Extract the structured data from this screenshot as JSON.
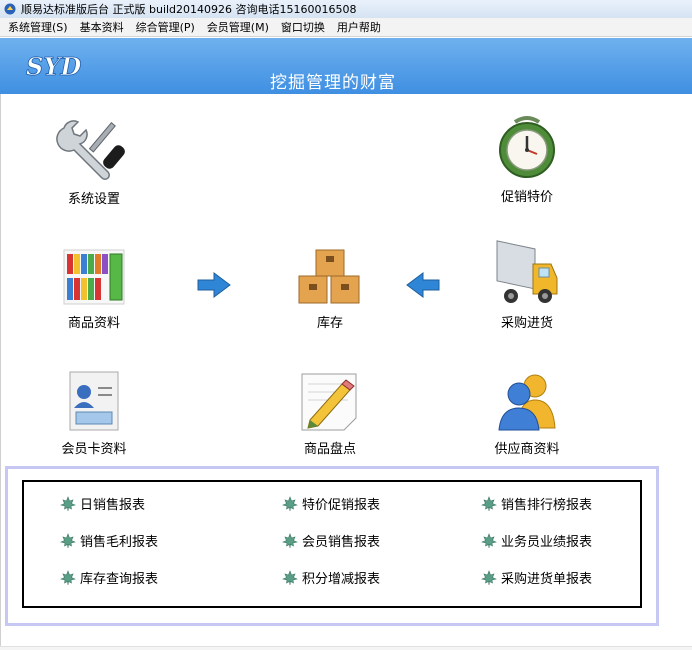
{
  "window": {
    "title": "顺易达标准版后台 正式版 build20140926 咨询电话15160016508"
  },
  "menu": [
    {
      "label": "系统管理(S)"
    },
    {
      "label": "基本资料"
    },
    {
      "label": "综合管理(P)"
    },
    {
      "label": "会员管理(M)"
    },
    {
      "label": "窗口切换"
    },
    {
      "label": "用户帮助"
    }
  ],
  "header": {
    "logo_text": "SYD",
    "slogan": "挖掘管理的财富",
    "colors": {
      "top": "#6fb1ee",
      "bottom": "#3f8fe2"
    }
  },
  "tiles": {
    "system_settings": {
      "label": "系统设置",
      "icon": "tools-icon"
    },
    "promotion": {
      "label": "促销特价",
      "icon": "alarm-clock-icon"
    },
    "product_info": {
      "label": "商品资料",
      "icon": "binders-icon"
    },
    "inventory": {
      "label": "库存",
      "icon": "boxes-icon"
    },
    "purchase": {
      "label": "采购进货",
      "icon": "delivery-truck-icon"
    },
    "member_card": {
      "label": "会员卡资料",
      "icon": "member-card-icon"
    },
    "stocktake": {
      "label": "商品盘点",
      "icon": "notepad-pencil-icon"
    },
    "supplier": {
      "label": "供应商资料",
      "icon": "people-icon"
    }
  },
  "reports": [
    {
      "label": "日销售报表"
    },
    {
      "label": "特价促销报表"
    },
    {
      "label": "销售排行榜报表"
    },
    {
      "label": "销售毛利报表"
    },
    {
      "label": "会员销售报表"
    },
    {
      "label": "业务员业绩报表"
    },
    {
      "label": "库存查询报表"
    },
    {
      "label": "积分增减报表"
    },
    {
      "label": "采购进货单报表"
    }
  ]
}
